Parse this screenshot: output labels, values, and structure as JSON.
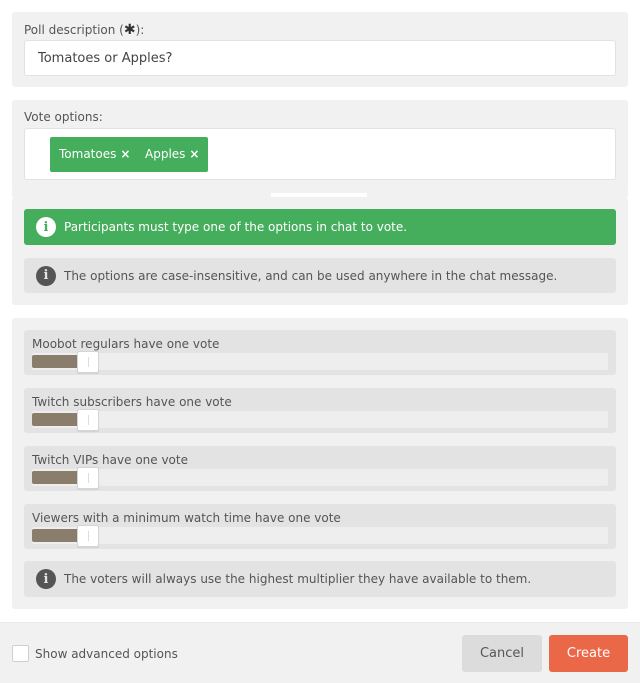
{
  "description": {
    "label_prefix": "Poll description (",
    "label_star": "✱",
    "label_suffix": "):",
    "value": "Tomatoes or Apples?"
  },
  "options": {
    "label": "Vote options:",
    "tags": [
      {
        "text": "Tomatoes",
        "remove": "×"
      },
      {
        "text": "Apples",
        "remove": "×"
      }
    ]
  },
  "info": {
    "primary": "Participants must type one of the options in chat to vote.",
    "secondary": "The options are case-insensitive, and can be used anywhere in the chat message.",
    "icon": "i"
  },
  "multipliers": {
    "rows": [
      {
        "label": "Moobot regulars have one vote",
        "level": 0.08
      },
      {
        "label": "Twitch subscribers have one vote",
        "level": 0.08
      },
      {
        "label": "Twitch VIPs have one vote",
        "level": 0.08
      },
      {
        "label": "Viewers with a minimum watch time have one vote",
        "level": 0.08
      }
    ],
    "note": "The voters will always use the highest multiplier they have available to them."
  },
  "footer": {
    "advanced_label": "Show advanced options",
    "cancel_label": "Cancel",
    "create_label": "Create"
  },
  "colors": {
    "accent_green": "#45ae5d",
    "create_orange": "#ea6848",
    "slider_fill": "#8b7d6b"
  }
}
